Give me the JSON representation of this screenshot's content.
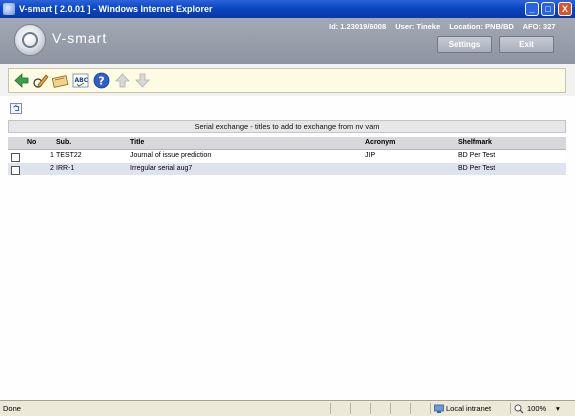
{
  "window": {
    "title": "V-smart [ 2.0.01 ] - Windows Internet Explorer",
    "minimize": "_",
    "maximize": "□",
    "close": "X"
  },
  "header": {
    "logo_text": "V-smart",
    "id_text": "Id: 1.23019/6008",
    "user_text": "User: Tineke",
    "location_text": "Location: PNB/BD",
    "afo_text": "AFO: 327",
    "settings_label": "Settings",
    "exit_label": "Exit"
  },
  "toolbar": {
    "icons": [
      "back-arrow-icon",
      "edit-pencil-icon",
      "card-icon",
      "spellcheck-icon",
      "help-icon",
      "up-arrow-icon",
      "down-arrow-icon"
    ]
  },
  "content": {
    "caption": "Serial exchange - titles to add to exchange from nv vam",
    "columns": [
      "No",
      "Sub.",
      "Title",
      "Acronym",
      "Shelfmark"
    ],
    "rows": [
      {
        "no": "1",
        "sub": "TEST22",
        "title": "Journal of issue prediction",
        "acronym": "JIP",
        "shelfmark": "BD Per Test"
      },
      {
        "no": "2",
        "sub": "IRR-1",
        "title": "Irregular serial aug7",
        "acronym": "",
        "shelfmark": "BD Per Test"
      }
    ]
  },
  "statusbar": {
    "status": "Done",
    "zone": "Local intranet",
    "zoom": "100%"
  },
  "colors": {
    "titlebar": "#0a47c2",
    "header": "#969eab",
    "toolbar": "#fdfbe3",
    "row_alt": "#dfe3ee"
  }
}
